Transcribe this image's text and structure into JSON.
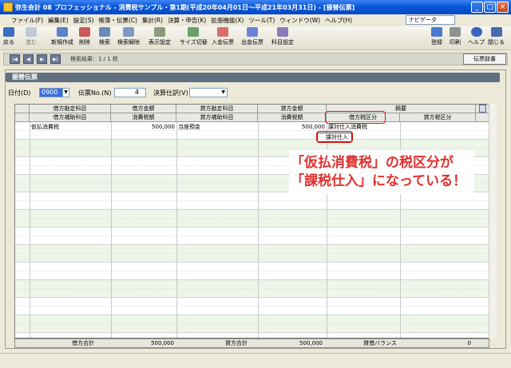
{
  "window": {
    "title": "弥生会計 08 プロフェッショナル - 消費税サンプル・第1期(平成20年04月01日～平成21年03月31日) - [振替伝票]"
  },
  "menu": [
    "ファイル(F)",
    "編集(E)",
    "設定(S)",
    "帳簿・伝票(C)",
    "集計(R)",
    "決算・申告(K)",
    "拡張機能(X)",
    "ツール(T)",
    "ウィンドウ(W)",
    "ヘルプ(H)"
  ],
  "navigator": "ナビゲータ",
  "toolbar": [
    {
      "label": "戻る",
      "icon": "back-arrow-icon"
    },
    {
      "label": "進む",
      "icon": "forward-arrow-icon"
    },
    {
      "label": "新規作成",
      "icon": "new-document-icon"
    },
    {
      "label": "削除",
      "icon": "delete-icon"
    },
    {
      "label": "検索",
      "icon": "search-icon"
    },
    {
      "label": "検索解除",
      "icon": "search-clear-icon"
    },
    {
      "label": "表示設定",
      "icon": "display-settings-icon"
    },
    {
      "label": "サイズ切替",
      "icon": "resize-icon"
    },
    {
      "label": "入金伝票",
      "icon": "deposit-slip-icon"
    },
    {
      "label": "出金伝票",
      "icon": "payment-slip-icon"
    },
    {
      "label": "科目設定",
      "icon": "account-settings-icon"
    }
  ],
  "toolbar_right": [
    {
      "label": "登録",
      "icon": "register-icon"
    },
    {
      "label": "印刷",
      "icon": "print-icon"
    },
    {
      "label": "ヘルプ",
      "icon": "help-icon"
    },
    {
      "label": "閉じる",
      "icon": "close-icon"
    }
  ],
  "pager": {
    "result_text": "検索結果：1 / 1 枚",
    "history_button": "伝票辞書"
  },
  "panel": {
    "title": "振替伝票",
    "date_label": "日付(D)",
    "date_value": "0900",
    "voucher_no_label": "伝票No.(N)",
    "voucher_no_value": "4",
    "settlement_label": "決算仕訳(V)",
    "settlement_value": ""
  },
  "grid": {
    "header_row1": [
      "借方勘定科目",
      "借方金額",
      "貸方勘定科目",
      "貸方金額",
      "摘要"
    ],
    "header_row2": [
      "借方補助科目",
      "消費税額",
      "貸方補助科目",
      "消費税額",
      "借方税区分",
      "貸方税区分"
    ],
    "rows": [
      {
        "debit_account": "仮払消費税",
        "debit_amount": "500,000",
        "credit_account": "当座預金",
        "credit_amount": "500,000",
        "debit_tax_category": "課対仕入消費税"
      }
    ],
    "dropdown_value": "課対仕入"
  },
  "totals": {
    "debit_total_label": "借方合計",
    "debit_total": "500,000",
    "credit_total_label": "貸方合計",
    "credit_total": "500,000",
    "balance_label": "貸借バランス",
    "balance": "0"
  },
  "annotation": {
    "line1": "「仮払消費税」の税区分が",
    "line2": "「課税仕入」になっている！",
    "color": "#e23030"
  }
}
